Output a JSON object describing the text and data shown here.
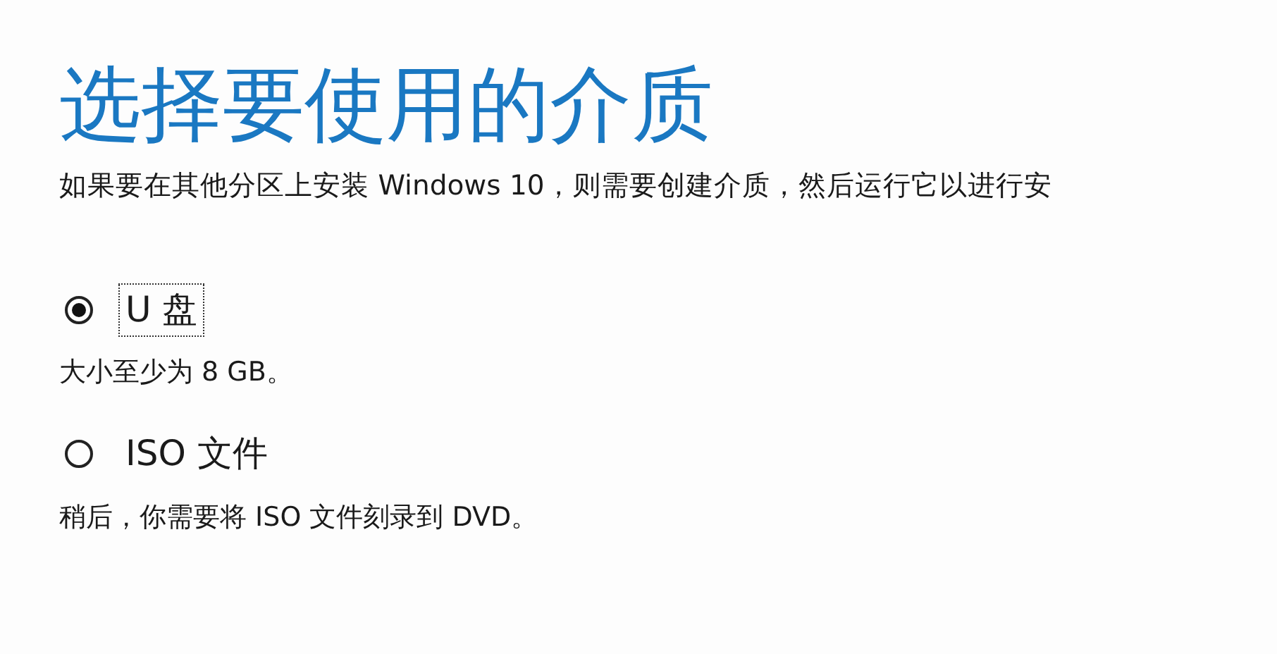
{
  "title": "选择要使用的介质",
  "subtitle": "如果要在其他分区上安装 Windows 10，则需要创建介质，然后运行它以进行安",
  "options": [
    {
      "label": "U 盘",
      "description": "大小至少为 8 GB。",
      "selected": true,
      "focused": true
    },
    {
      "label": "ISO 文件",
      "description": "稍后，你需要将 ISO 文件刻录到 DVD。",
      "selected": false,
      "focused": false
    }
  ]
}
